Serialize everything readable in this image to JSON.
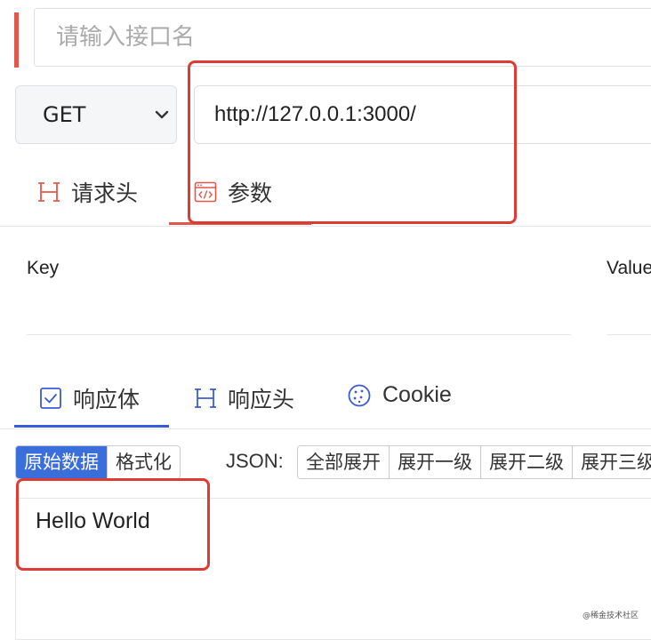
{
  "name_input": {
    "placeholder": "请输入接口名"
  },
  "method": {
    "selected": "GET"
  },
  "url": {
    "value": "http://127.0.0.1:3000/"
  },
  "request_tabs": [
    {
      "label": "请求头",
      "icon": "h-icon"
    },
    {
      "label": "参数",
      "icon": "code-window-icon"
    }
  ],
  "params": {
    "key_header": "Key",
    "value_header": "Value"
  },
  "response_tabs": [
    {
      "label": "响应体",
      "icon": "checkbox-icon"
    },
    {
      "label": "响应头",
      "icon": "h-icon"
    },
    {
      "label": "Cookie",
      "icon": "cookie-icon"
    }
  ],
  "view_mode": {
    "raw": "原始数据",
    "formatted": "格式化"
  },
  "json": {
    "label": "JSON:",
    "buttons": [
      "全部展开",
      "展开一级",
      "展开二级",
      "展开三级"
    ]
  },
  "response_body": "Hello World",
  "watermark": "@稀金技术社区",
  "colors": {
    "accent_red": "#e2574c",
    "accent_blue": "#3a5bd9",
    "highlight_box": "#dd3b33"
  }
}
